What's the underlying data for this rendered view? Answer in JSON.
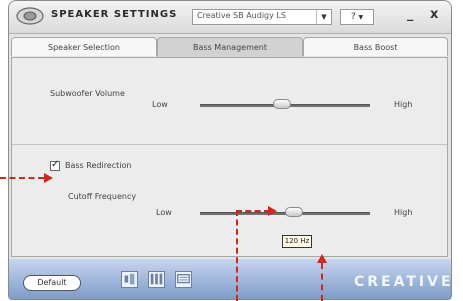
{
  "window": {
    "title": "SPEAKER SETTINGS",
    "device": "Creative SB Audigy LS",
    "help_label": "?",
    "minimize": "_",
    "close": "x"
  },
  "tabs": [
    {
      "label": "Speaker Selection",
      "active": false
    },
    {
      "label": "Bass Management",
      "active": true
    },
    {
      "label": "Bass Boost",
      "active": false
    }
  ],
  "subwoofer": {
    "label": "Subwoofer Volume",
    "low": "Low",
    "high": "High",
    "level": 0.48
  },
  "bass_redirection": {
    "label": "Bass Redirection",
    "checked": true
  },
  "cutoff": {
    "label": "Cutoff Frequency",
    "low": "Low",
    "high": "High",
    "level": 0.55,
    "value": "120 Hz"
  },
  "footer": {
    "default_label": "Default",
    "brand": "CREATIVE",
    "icons": [
      "speaker-config-icon",
      "equalizer-icon",
      "display-icon"
    ]
  },
  "colors": {
    "annotation": "#d8251a",
    "footer": "#7e9cc8"
  }
}
